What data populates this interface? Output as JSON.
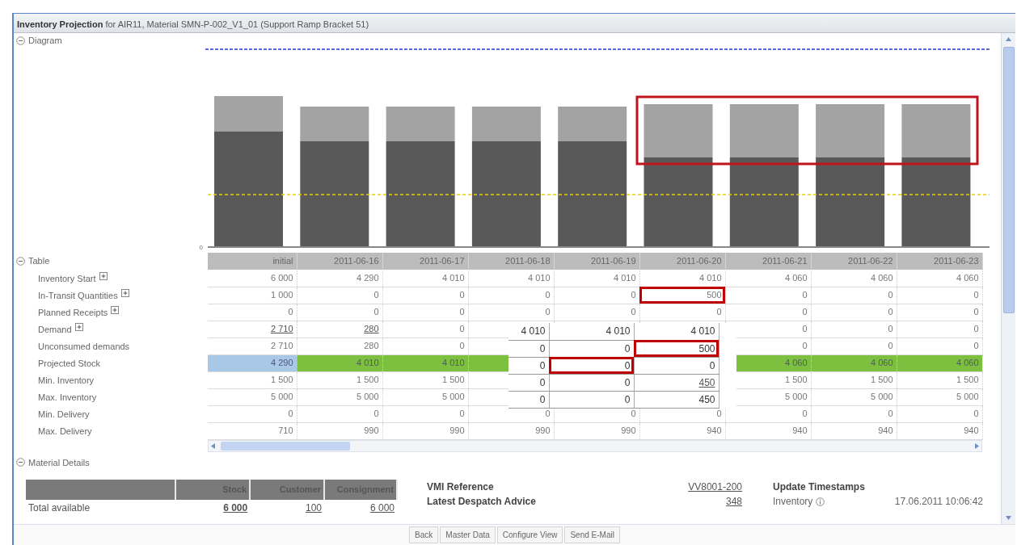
{
  "window": {
    "title": "**Inventory Projection** for AIR11, Material SMN-P-002_V1_01 (Support Ramp Bracket 51)"
  },
  "diagram": {
    "heading": "Diagram",
    "expanded": true,
    "y_tick": "0"
  },
  "table": {
    "heading": "Table",
    "expanded": true,
    "columns": [
      "initial",
      "2011-06-16",
      "2011-06-17",
      "2011-06-18",
      "2011-06-19",
      "2011-06-20",
      "2011-06-21",
      "2011-06-22",
      "2011-06-23"
    ],
    "rows": [
      {
        "label": "Inventory Start",
        "expandable": true,
        "cells": [
          "6 000",
          "4 290",
          "4 010",
          "4 010",
          "4 010",
          "4 010",
          "4 060",
          "4 060",
          "4 060"
        ]
      },
      {
        "label": "In-Transit Quantities",
        "expandable": true,
        "cells": [
          "1 000",
          "0",
          "0",
          "0",
          "0",
          {
            "text": "500",
            "highlighted": true
          },
          "0",
          "0",
          "0"
        ]
      },
      {
        "label": "Planned Receipts",
        "expandable": true,
        "cells": [
          "0",
          "0",
          "0",
          "0",
          "0",
          "0",
          "0",
          "0",
          "0"
        ]
      },
      {
        "label": "Demand",
        "expandable": true,
        "cells": [
          {
            "text": "2 710",
            "link": true
          },
          {
            "text": "280",
            "link": true
          },
          "0",
          null,
          null,
          null,
          "0",
          "0",
          "0"
        ]
      },
      {
        "label": "Unconsumed demands",
        "cells": [
          "2 710",
          "280",
          "0",
          null,
          null,
          null,
          "0",
          "0",
          "0"
        ]
      },
      {
        "label": "Projected Stock",
        "cells": [
          {
            "text": "4 290",
            "color": "#a9c8e8"
          },
          {
            "text": "4 010",
            "color": "#7dbf3f"
          },
          {
            "text": "4 010",
            "color": "#7dbf3f"
          },
          {
            "text": null,
            "color": "#7dbf3f"
          },
          null,
          null,
          {
            "text": "4 060",
            "color": "#7dbf3f"
          },
          {
            "text": "4 060",
            "color": "#7dbf3f"
          },
          {
            "text": "4 060",
            "color": "#7dbf3f"
          }
        ]
      },
      {
        "label": "Min. Inventory",
        "cells": [
          "1 500",
          "1 500",
          "1 500",
          null,
          null,
          null,
          "1 500",
          "1 500",
          "1 500"
        ]
      },
      {
        "label": "Max. Inventory",
        "cells": [
          "5 000",
          "5 000",
          "5 000",
          null,
          null,
          null,
          "5 000",
          "5 000",
          "5 000"
        ]
      },
      {
        "label": "Min. Delivery",
        "cells": [
          "0",
          "0",
          "0",
          "0",
          "0",
          "0",
          "0",
          "0",
          "0"
        ]
      },
      {
        "label": "Max. Delivery",
        "cells": [
          "710",
          "990",
          "990",
          "990",
          "990",
          "940",
          "940",
          "940",
          "940"
        ]
      }
    ],
    "inset_rows": [
      [
        "4 010",
        "4 010",
        "4 010"
      ],
      [
        "0",
        "0",
        {
          "text": "500",
          "highlighted": true
        }
      ],
      [
        "0",
        {
          "text": "0",
          "highlighted": true
        },
        "0"
      ],
      [
        "0",
        "0",
        {
          "text": "450",
          "link": true
        }
      ],
      [
        "0",
        "0",
        "450"
      ]
    ]
  },
  "material_details": {
    "heading": "Material Details",
    "expanded": true,
    "stock_columns": [
      "Stock",
      "Customer",
      "Consignment"
    ],
    "stock_rows": [
      {
        "label": "Total available",
        "cells": [
          {
            "text": "6 000",
            "link": true,
            "bold": true
          },
          {
            "text": "100",
            "link": true
          },
          {
            "text": "6 000",
            "link": true
          }
        ]
      }
    ],
    "references": [
      {
        "label": "VMI Reference",
        "value": "VV8001-200"
      },
      {
        "label": "Latest Despatch Advice",
        "value": "348"
      }
    ],
    "timestamps_heading": "Update Timestamps",
    "timestamps": [
      {
        "label": "Inventory",
        "value": "17.06.2011 10:06:42"
      }
    ]
  },
  "buttons": [
    "Back",
    "Master Data",
    "Configure View",
    "Send E-Mail"
  ]
}
